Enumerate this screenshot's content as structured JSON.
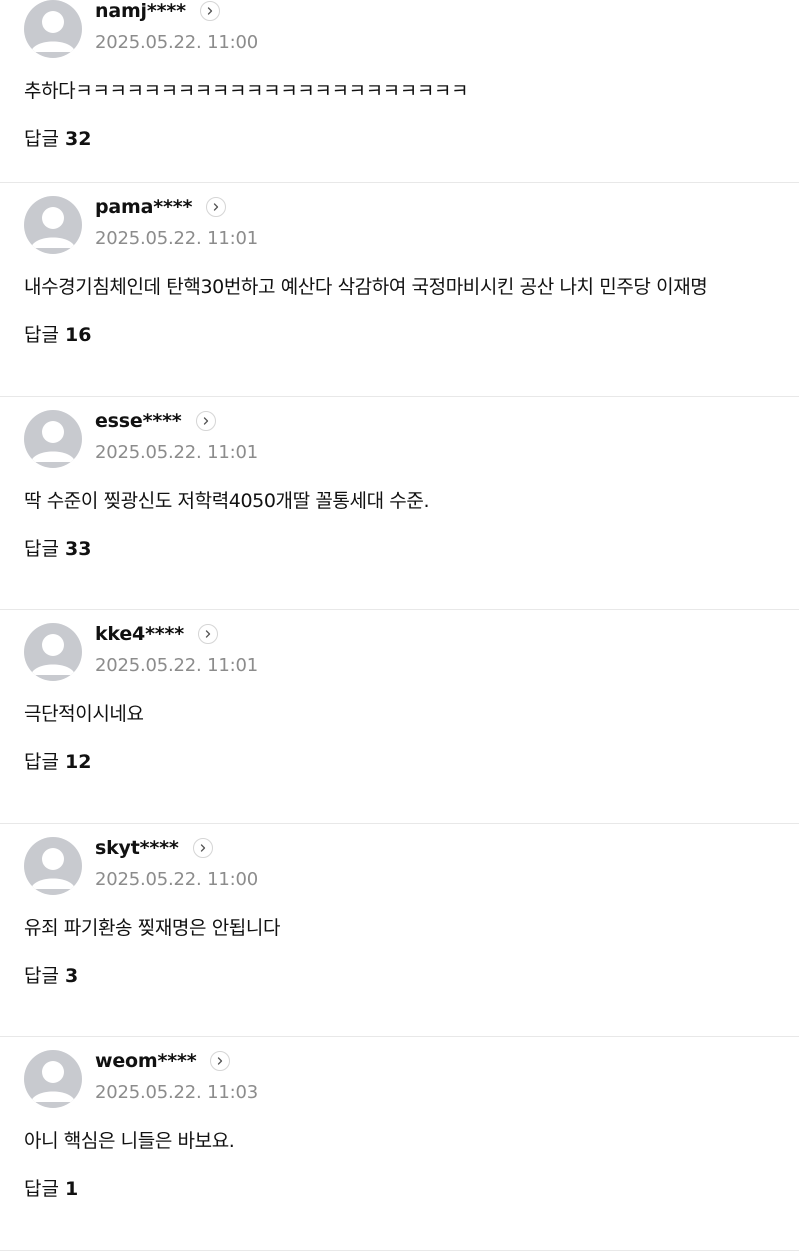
{
  "comments": [
    {
      "username": "namj****",
      "timestamp": "2025.05.22. 11:00",
      "text": "추하다ㅋㅋㅋㅋㅋㅋㅋㅋㅋㅋㅋㅋㅋㅋㅋㅋㅋㅋㅋㅋㅋㅋㅋ",
      "reply_label": "답글",
      "reply_count": "32"
    },
    {
      "username": "pama****",
      "timestamp": "2025.05.22. 11:01",
      "text": "내수경기침체인데 탄핵30번하고 예산다 삭감하여 국정마비시킨 공산 나치 민주당 이재명",
      "reply_label": "답글",
      "reply_count": "16"
    },
    {
      "username": "esse****",
      "timestamp": "2025.05.22. 11:01",
      "text": "딱 수준이 찢광신도 저학력4050개딸 꼴통세대 수준.",
      "reply_label": "답글",
      "reply_count": "33"
    },
    {
      "username": "kke4****",
      "timestamp": "2025.05.22. 11:01",
      "text": "극단적이시네요",
      "reply_label": "답글",
      "reply_count": "12"
    },
    {
      "username": "skyt****",
      "timestamp": "2025.05.22. 11:00",
      "text": "유죄 파기환송 찢재명은 안됩니다",
      "reply_label": "답글",
      "reply_count": "3"
    },
    {
      "username": "weom****",
      "timestamp": "2025.05.22. 11:03",
      "text": "아니 핵심은 니들은 바보요.",
      "reply_label": "답글",
      "reply_count": "1"
    }
  ],
  "icons": {
    "avatar": "default-user-avatar-icon",
    "profile_link": "chevron-right-circle-icon"
  },
  "colors": {
    "avatar_bg": "#c8cacf",
    "avatar_fg": "#ffffff",
    "timestamp": "#8c8c8c",
    "divider": "#e8e8e8"
  }
}
